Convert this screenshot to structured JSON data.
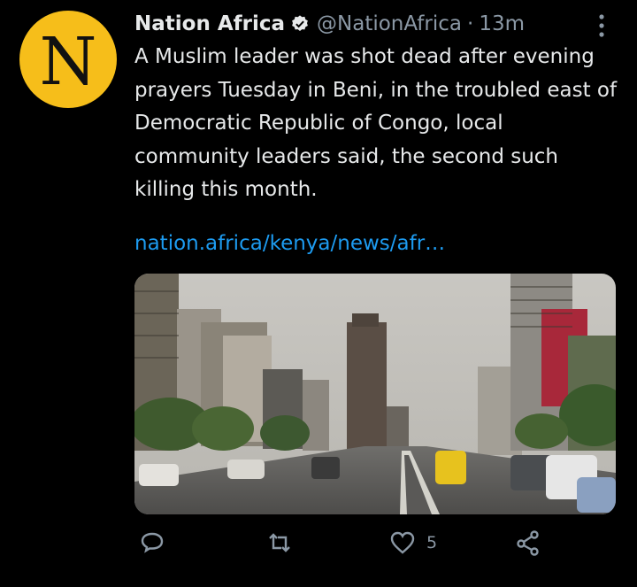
{
  "tweet": {
    "avatar_letter": "N",
    "display_name": "Nation Africa",
    "handle": "@NationAfrica",
    "separator": "·",
    "time": "13m",
    "text": "A Muslim leader was shot dead after evening prayers Tuesday in Beni, in the troubled east of Democratic Republic of Congo, local community leaders said, the second such killing this month.",
    "link": "nation.africa/kenya/news/afr…",
    "like_count": "5"
  },
  "icons": {
    "verified": "verified-badge-icon",
    "more": "more-vertical-icon",
    "reply": "reply-icon",
    "retweet": "retweet-icon",
    "like": "heart-icon",
    "share": "share-icon"
  },
  "colors": {
    "background": "#000000",
    "avatar_bg": "#f6be1a",
    "link": "#1d9bf0",
    "secondary_text": "#8b98a5",
    "primary_text": "#e7e9ea"
  }
}
